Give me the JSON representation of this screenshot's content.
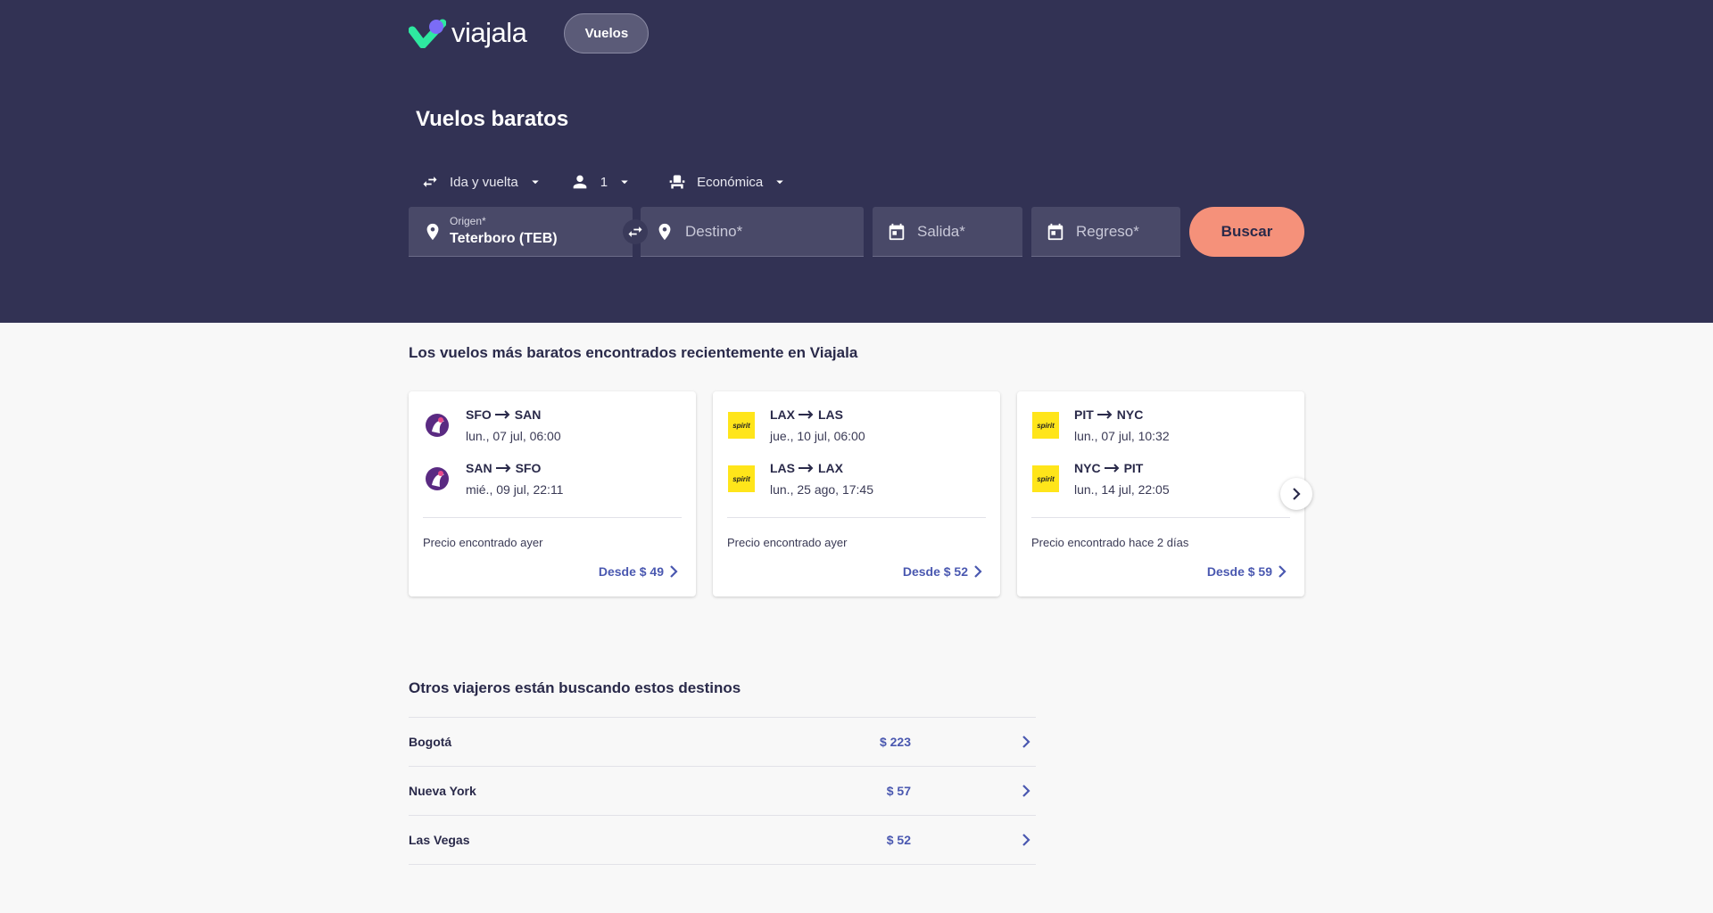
{
  "brand": {
    "name": "viajala"
  },
  "nav": {
    "flights_label": "Vuelos"
  },
  "hero": {
    "title": "Vuelos baratos"
  },
  "options": {
    "trip_type": "Ida y vuelta",
    "passengers": "1",
    "cabin": "Económica"
  },
  "form": {
    "origin_label": "Origen*",
    "origin_value": "Teterboro (TEB)",
    "destination_placeholder": "Destino*",
    "departure_placeholder": "Salida*",
    "return_placeholder": "Regreso*",
    "search_label": "Buscar"
  },
  "deals": {
    "title": "Los vuelos más baratos encontrados recientemente en Viajala",
    "cards": [
      {
        "airline_icon": "hawaiian-airlines-logo",
        "legs": [
          {
            "from": "SFO",
            "to": "SAN",
            "date": "lun., 07 jul, 06:00"
          },
          {
            "from": "SAN",
            "to": "SFO",
            "date": "mié., 09 jul, 22:11"
          }
        ],
        "found": "Precio encontrado ayer",
        "price": "Desde $ 49"
      },
      {
        "airline_icon": "spirit-logo",
        "airline_text": "spirit",
        "legs": [
          {
            "from": "LAX",
            "to": "LAS",
            "date": "jue., 10 jul, 06:00"
          },
          {
            "from": "LAS",
            "to": "LAX",
            "date": "lun., 25 ago, 17:45"
          }
        ],
        "found": "Precio encontrado ayer",
        "price": "Desde $ 52"
      },
      {
        "airline_icon": "spirit-logo",
        "airline_text": "spirit",
        "legs": [
          {
            "from": "PIT",
            "to": "NYC",
            "date": "lun., 07 jul, 10:32"
          },
          {
            "from": "NYC",
            "to": "PIT",
            "date": "lun., 14 jul, 22:05"
          }
        ],
        "found": "Precio encontrado hace 2 días",
        "price": "Desde $ 59"
      }
    ]
  },
  "popular": {
    "title": "Otros viajeros están buscando estos destinos",
    "items": [
      {
        "name": "Bogotá",
        "price": "$ 223"
      },
      {
        "name": "Nueva York",
        "price": "$ 57"
      },
      {
        "name": "Las Vegas",
        "price": "$ 52"
      }
    ]
  },
  "colors": {
    "hero_bg": "#323254",
    "accent_button": "#f5917a",
    "link_blue": "#4a58b0",
    "logo_green": "#2ee8a0",
    "logo_purple": "#7b6cf6"
  }
}
